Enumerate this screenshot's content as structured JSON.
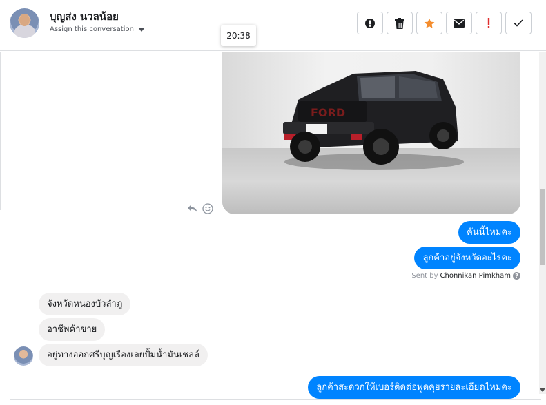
{
  "header": {
    "contact_name": "บุญส่ง นวลน้อย",
    "assign_label": "Assign this conversation",
    "toolbar": {
      "spam_icon": "exclamation-circle-icon",
      "delete_icon": "trash-icon",
      "star_icon": "star-icon",
      "mark_unread_icon": "envelope-icon",
      "follow_up_icon": "exclamation-icon",
      "done_icon": "checkmark-icon"
    },
    "colors": {
      "star": "#f48d2e",
      "follow_up": "#e02e2e"
    }
  },
  "tooltip": {
    "time": "20:38"
  },
  "thread": {
    "image": {
      "description_icon": "car-photo"
    },
    "image_actions": {
      "forward_icon": "reply-arrow-icon",
      "react_icon": "smiley-icon"
    },
    "outgoing": [
      {
        "text": "คันนี้ไหมคะ"
      },
      {
        "text": "ลูกค้าอยู่จังหวัดอะไรคะ"
      }
    ],
    "sent_by": {
      "prefix": "Sent by",
      "name": "Chonnikan Pimkham",
      "help": "?"
    },
    "incoming": [
      {
        "text": "จังหวัดหนองบัวลำภู"
      },
      {
        "text": "อาชีพค้าขาย"
      },
      {
        "text": "อยู่ทางออกศรีบุญเรืองเลยปั้มน้ำมันเชลล์"
      }
    ],
    "outgoing_last": {
      "text": "ลูกค้าสะดวกให้เบอร์ติดต่อพูดคุยรายละเอียดไหมคะ"
    }
  },
  "colors": {
    "outgoing_bubble": "#0084ff",
    "incoming_bubble": "#f1f0f0"
  }
}
